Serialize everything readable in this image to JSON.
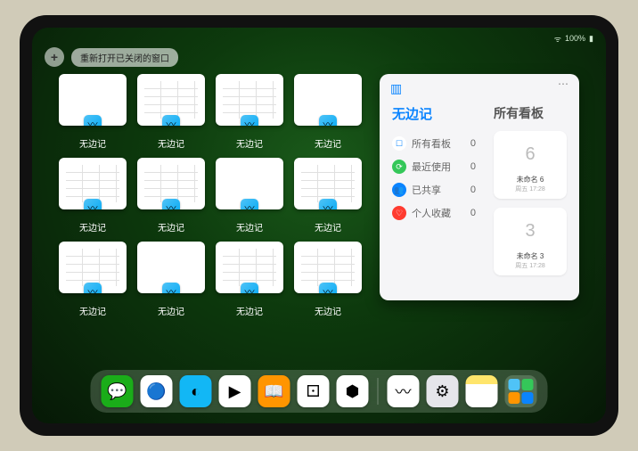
{
  "status": {
    "time": "",
    "battery": "100%",
    "wifi": "􀙇"
  },
  "topbar": {
    "reopen_label": "重新打开已关闭的窗口",
    "plus": "+"
  },
  "app_switcher": {
    "app_name": "无边记",
    "thumbs": [
      {
        "label": "无边记",
        "variant": "plain"
      },
      {
        "label": "无边记",
        "variant": "lined"
      },
      {
        "label": "无边记",
        "variant": "lined"
      },
      {
        "label": "无边记",
        "variant": "plain"
      },
      {
        "label": "无边记",
        "variant": "lined"
      },
      {
        "label": "无边记",
        "variant": "lined"
      },
      {
        "label": "无边记",
        "variant": "plain"
      },
      {
        "label": "无边记",
        "variant": "lined"
      },
      {
        "label": "无边记",
        "variant": "lined"
      },
      {
        "label": "无边记",
        "variant": "plain"
      },
      {
        "label": "无边记",
        "variant": "lined"
      },
      {
        "label": "无边记",
        "variant": "lined"
      }
    ]
  },
  "panel": {
    "title": "无边记",
    "right_title": "所有看板",
    "categories": [
      {
        "icon_bg": "#ffffff",
        "icon_fg": "#0a84ff",
        "icon": "☐",
        "label": "所有看板",
        "count": "0"
      },
      {
        "icon_bg": "#34c759",
        "icon": "⟳",
        "label": "最近使用",
        "count": "0"
      },
      {
        "icon_bg": "#0a84ff",
        "icon": "👥",
        "label": "已共享",
        "count": "0"
      },
      {
        "icon_bg": "#ff3b30",
        "icon": "♡",
        "label": "个人收藏",
        "count": "0"
      }
    ],
    "boards": [
      {
        "glyph": "6",
        "name": "未命名 6",
        "date": "周五 17:28"
      },
      {
        "glyph": "3",
        "name": "未命名 3",
        "date": "周五 17:28"
      }
    ],
    "more": "⋯"
  },
  "dock": {
    "apps": [
      {
        "name": "wechat",
        "bg": "#1aad19",
        "glyph": "💬"
      },
      {
        "name": "qqbrowser",
        "bg": "#ffffff",
        "glyph": "🔵"
      },
      {
        "name": "qq",
        "bg": "#12b7f5",
        "glyph": "◐"
      },
      {
        "name": "play",
        "bg": "#ffffff",
        "glyph": "▶"
      },
      {
        "name": "books",
        "bg": "#ff9500",
        "glyph": "📖"
      },
      {
        "name": "game",
        "bg": "#ffffff",
        "glyph": "⚀"
      },
      {
        "name": "xmind",
        "bg": "#ffffff",
        "glyph": "⬢"
      }
    ],
    "recent": [
      {
        "name": "freeform",
        "bg": "#ffffff",
        "glyph": "〰"
      },
      {
        "name": "settings",
        "bg": "#e5e5ea",
        "glyph": "⚙"
      },
      {
        "name": "notes",
        "bg": "linear-gradient(to bottom,#ffe56b 0%,#ffe56b 28%,#fff 28%,#fff 100%)",
        "glyph": ""
      }
    ]
  }
}
